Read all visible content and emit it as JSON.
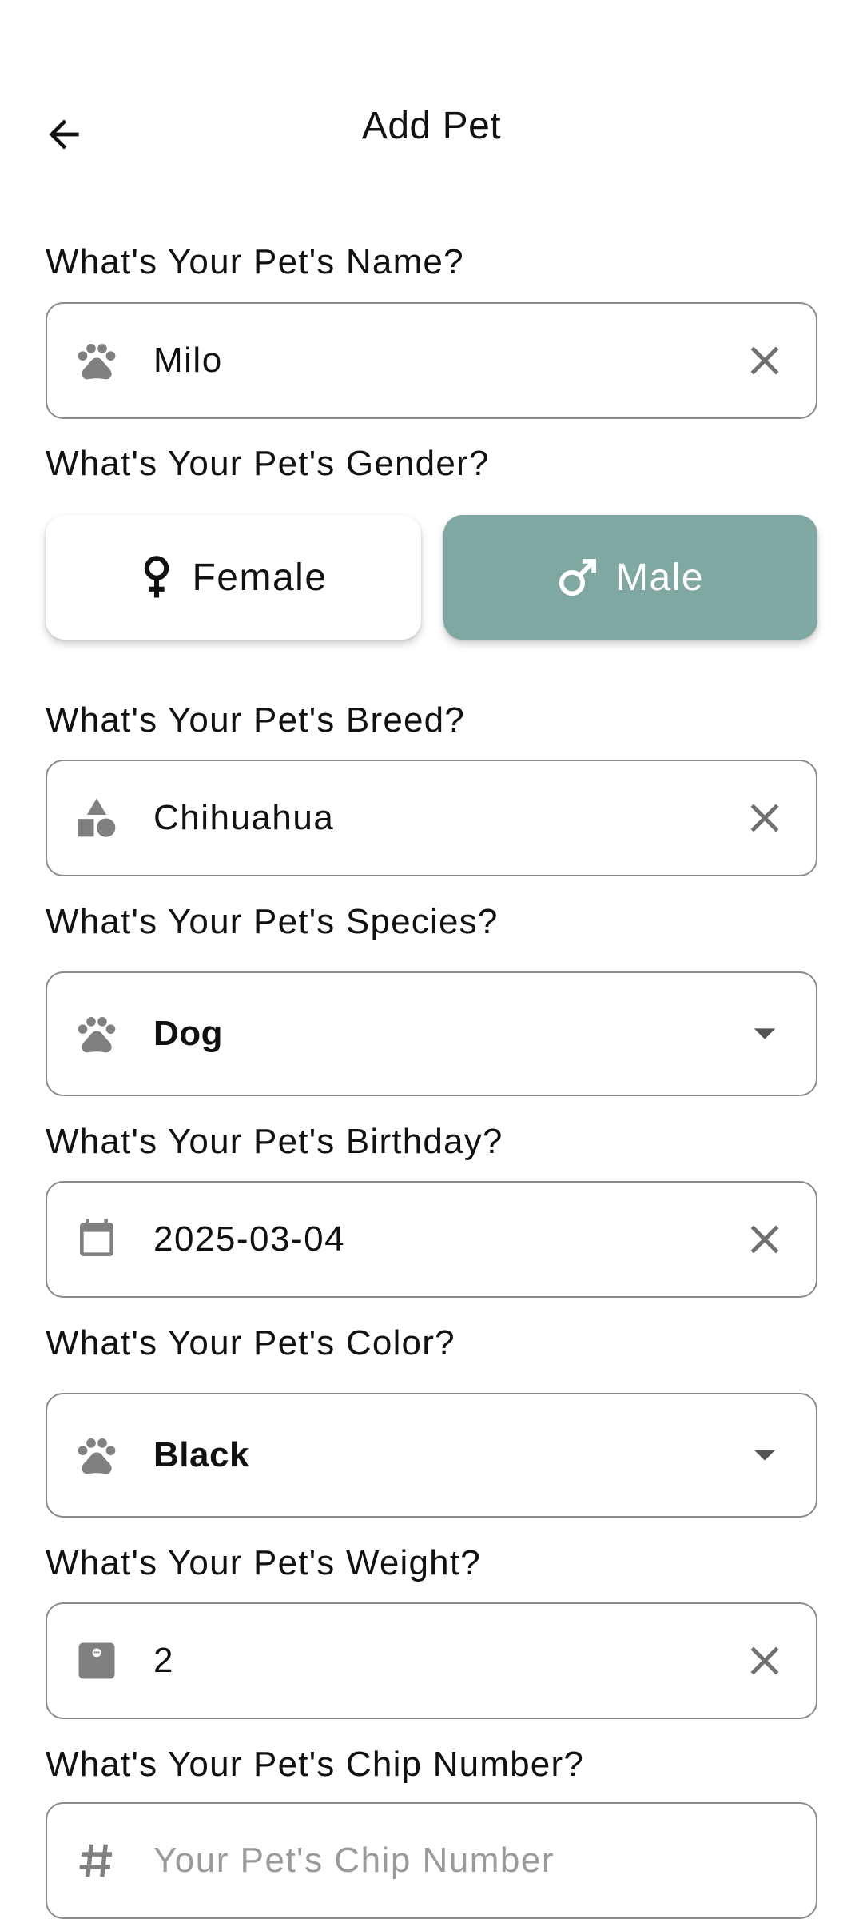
{
  "header": {
    "title": "Add Pet",
    "back_icon": "arrow-left-icon"
  },
  "name": {
    "label": "What's Your Pet's Name?",
    "value": "Milo",
    "icon": "paw-icon"
  },
  "gender": {
    "label": "What's Your Pet's Gender?",
    "options": [
      {
        "label": "Female",
        "icon": "female-icon",
        "selected": false
      },
      {
        "label": "Male",
        "icon": "male-icon",
        "selected": true
      }
    ],
    "selected_color": "#7ea8a1"
  },
  "breed": {
    "label": "What's Your Pet's Breed?",
    "value": "Chihuahua",
    "icon": "shapes-icon"
  },
  "species": {
    "label": "What's Your Pet's Species?",
    "value": "Dog",
    "icon": "paw-icon"
  },
  "birthday": {
    "label": "What's Your Pet's Birthday?",
    "value": "2025-03-04",
    "icon": "calendar-icon"
  },
  "color": {
    "label": "What's Your Pet's Color?",
    "value": "Black",
    "icon": "paw-icon"
  },
  "weight": {
    "label": "What's Your Pet's Weight?",
    "value": "2",
    "icon": "scale-icon"
  },
  "chip": {
    "label": "What's Your Pet's Chip Number?",
    "placeholder": "Your Pet's Chip Number",
    "icon": "hash-icon"
  }
}
